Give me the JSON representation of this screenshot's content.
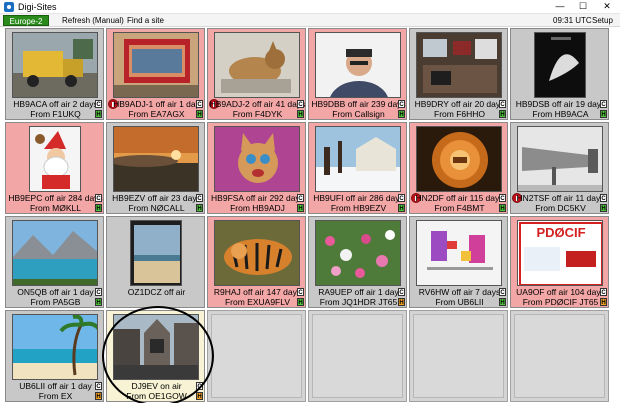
{
  "window": {
    "title": "Digi-Sites",
    "minimize": "—",
    "maximize": "☐",
    "close": "✕"
  },
  "toolbar": {
    "region": "Europe-2",
    "refresh": "Refresh (Manual)",
    "find": "Find a site",
    "time": "09:31 UTC",
    "setup": "Setup"
  },
  "sites": [
    {
      "line1": "HB9ACA off air 2 days",
      "line2": "From  F1UKQ",
      "status": "grey",
      "c": "C",
      "h": "H",
      "hcolor": "green",
      "proto": false,
      "thumb": "truck"
    },
    {
      "line1": "HB9ADJ-1 off air 1 day",
      "line2": "From  EA7AGX",
      "status": "red",
      "c": "C",
      "h": "H",
      "hcolor": "green",
      "proto": true,
      "thumb": "replay"
    },
    {
      "line1": "HB9ADJ-2 off air 41 days",
      "line2": "From  F4DYK",
      "status": "red",
      "c": "C",
      "h": "H",
      "hcolor": "green",
      "proto": true,
      "thumb": "cat"
    },
    {
      "line1": "HB9DBB off air 239 days",
      "line2": "From  Callsign",
      "status": "red",
      "c": "C",
      "h": "H",
      "hcolor": "green",
      "proto": false,
      "thumb": "man"
    },
    {
      "line1": "HB9DRY off air 20 days",
      "line2": "From  F6HHO",
      "status": "grey",
      "c": "C",
      "h": "H",
      "hcolor": "green",
      "proto": false,
      "thumb": "room"
    },
    {
      "line1": "HB9DSB off air 19 days",
      "line2": "From  HB9ACA",
      "status": "grey",
      "c": "C",
      "h": "H",
      "hcolor": "green",
      "proto": false,
      "thumb": "dark"
    },
    {
      "line1": "HB9EPC off air 284 days",
      "line2": "From  MØKLL",
      "status": "red",
      "c": "C",
      "h": "H",
      "hcolor": "green",
      "proto": false,
      "thumb": "santa"
    },
    {
      "line1": "HB9EZV off air 23 days",
      "line2": "From  NØCALL",
      "status": "grey",
      "c": "C",
      "h": "H",
      "hcolor": "green",
      "proto": false,
      "thumb": "sunset"
    },
    {
      "line1": "HB9FSA off air 292 days",
      "line2": "From  HB9ADJ",
      "status": "red",
      "c": "C",
      "h": "H",
      "hcolor": "green",
      "proto": false,
      "thumb": "kitten"
    },
    {
      "line1": "HB9UFI off air 286 days",
      "line2": "From  HB9EZV",
      "status": "red",
      "c": "C",
      "h": "H",
      "hcolor": "green",
      "proto": false,
      "thumb": "snow"
    },
    {
      "line1": "HN2DF off air 115 days",
      "line2": "From  F4BMT",
      "status": "red",
      "c": "C",
      "h": "H",
      "hcolor": "green",
      "proto": true,
      "thumb": "tunnel"
    },
    {
      "line1": "HN2TSF off air 11 days",
      "line2": "From  DC5KV",
      "status": "grey",
      "c": "C",
      "h": "H",
      "hcolor": "green",
      "proto": true,
      "thumb": "horn"
    },
    {
      "line1": "ON5QB off air 1 day",
      "line2": "From  PA5GB",
      "status": "grey",
      "c": "C",
      "h": "H",
      "hcolor": "green",
      "proto": false,
      "thumb": "lake"
    },
    {
      "line1": "OZ1DCZ off air",
      "line2": "",
      "status": "grey",
      "c": "",
      "h": "",
      "hcolor": "green",
      "proto": false,
      "thumb": "beach"
    },
    {
      "line1": "R9HAJ off air 147 days",
      "line2": "From  EXUA9FLV",
      "status": "red",
      "c": "C",
      "h": "H",
      "hcolor": "green",
      "proto": false,
      "thumb": "tiger"
    },
    {
      "line1": "RA9UEP off air 1 day",
      "line2": "From  JQ1HDR JT65",
      "status": "grey",
      "c": "C",
      "h": "H",
      "hcolor": "orange",
      "proto": false,
      "thumb": "flowers"
    },
    {
      "line1": "RV6HW off air 7 days",
      "line2": "From  UB6LII",
      "status": "grey",
      "c": "C",
      "h": "H",
      "hcolor": "green",
      "proto": false,
      "thumb": "pattern"
    },
    {
      "line1": "UA9OF off air 104 days",
      "line2": "From  PDØCIF JT65",
      "status": "red",
      "c": "C",
      "h": "H",
      "hcolor": "orange",
      "proto": false,
      "thumb": "qsl",
      "qsl_text": "PDØCIF"
    },
    {
      "line1": "UB6LII off air 1 day",
      "line2": "From  EX",
      "status": "grey",
      "c": "C",
      "h": "H",
      "hcolor": "orange",
      "proto": false,
      "thumb": "tropic"
    },
    {
      "line1": "DJ9EV on air",
      "line2": "From  OE1GOW",
      "status": "yellow",
      "c": "C",
      "h": "H",
      "hcolor": "orange",
      "proto": false,
      "thumb": "street"
    }
  ]
}
